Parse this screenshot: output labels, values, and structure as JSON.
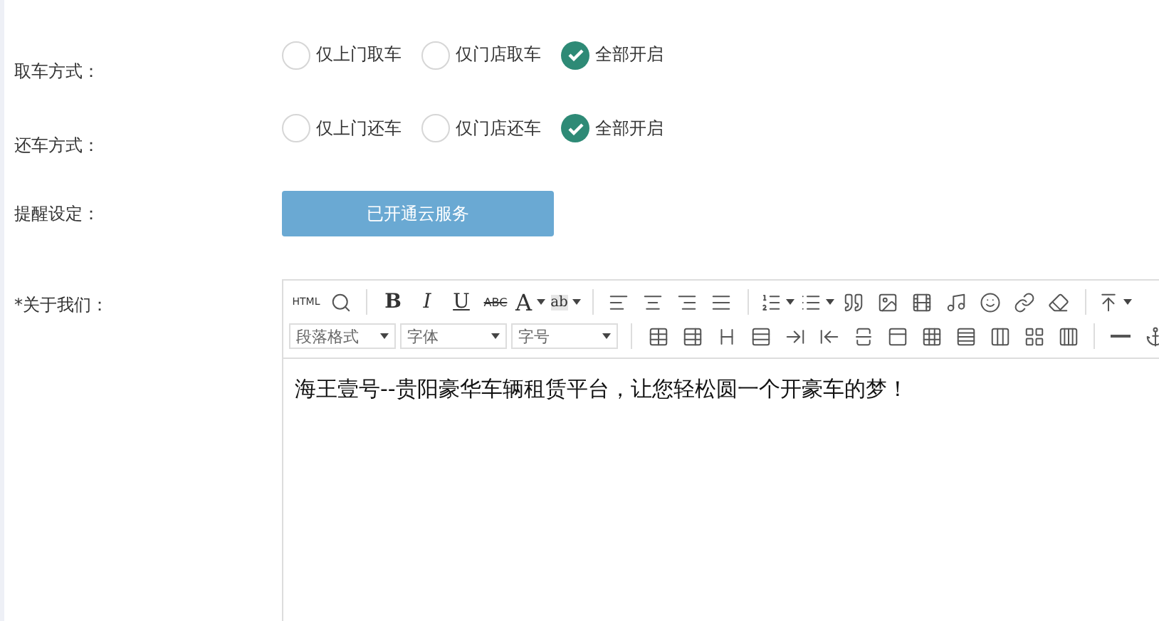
{
  "pickup": {
    "label": "取车方式：",
    "options": [
      {
        "label": "仅上门取车",
        "selected": false
      },
      {
        "label": "仅门店取车",
        "selected": false
      },
      {
        "label": "全部开启",
        "selected": true
      }
    ]
  },
  "return": {
    "label": "还车方式：",
    "options": [
      {
        "label": "仅上门还车",
        "selected": false
      },
      {
        "label": "仅门店还车",
        "selected": false
      },
      {
        "label": "全部开启",
        "selected": true
      }
    ]
  },
  "reminder": {
    "label": "提醒设定：",
    "button": "已开通云服务"
  },
  "about": {
    "label": "*关于我们：",
    "toolbar_row_1": [
      {
        "kind": "text",
        "label": "HTML"
      },
      {
        "kind": "icon"
      },
      {
        "kind": "sep"
      },
      {
        "kind": "text",
        "label": "B"
      },
      {
        "kind": "text",
        "label": "I"
      },
      {
        "kind": "text",
        "label": "U"
      },
      {
        "kind": "text",
        "label": "ABC"
      },
      {
        "kind": "text",
        "label": "A"
      },
      {
        "kind": "text",
        "label": "ab"
      },
      {
        "kind": "sep"
      },
      {
        "kind": "icon"
      },
      {
        "kind": "icon"
      },
      {
        "kind": "icon"
      },
      {
        "kind": "icon"
      },
      {
        "kind": "sep"
      },
      {
        "kind": "icon"
      },
      {
        "kind": "icon"
      },
      {
        "kind": "icon"
      },
      {
        "kind": "icon"
      },
      {
        "kind": "icon"
      },
      {
        "kind": "icon"
      },
      {
        "kind": "icon"
      },
      {
        "kind": "icon"
      },
      {
        "kind": "icon"
      },
      {
        "kind": "sep"
      },
      {
        "kind": "icon"
      }
    ],
    "toolbar_row_2": [
      {
        "kind": "select",
        "label": "段落格式"
      },
      {
        "kind": "select",
        "label": "字体"
      },
      {
        "kind": "select",
        "label": "字号"
      },
      {
        "kind": "sep"
      },
      {
        "kind": "icon"
      },
      {
        "kind": "icon"
      },
      {
        "kind": "icon"
      },
      {
        "kind": "icon"
      },
      {
        "kind": "icon"
      },
      {
        "kind": "icon"
      },
      {
        "kind": "icon"
      },
      {
        "kind": "icon"
      },
      {
        "kind": "icon"
      },
      {
        "kind": "icon"
      },
      {
        "kind": "icon"
      },
      {
        "kind": "icon"
      },
      {
        "kind": "icon"
      },
      {
        "kind": "sep"
      },
      {
        "kind": "icon"
      },
      {
        "kind": "icon"
      }
    ],
    "content": "海王壹号--贵阳豪华车辆租赁平台，让您轻松圆一个开豪车的梦！"
  }
}
